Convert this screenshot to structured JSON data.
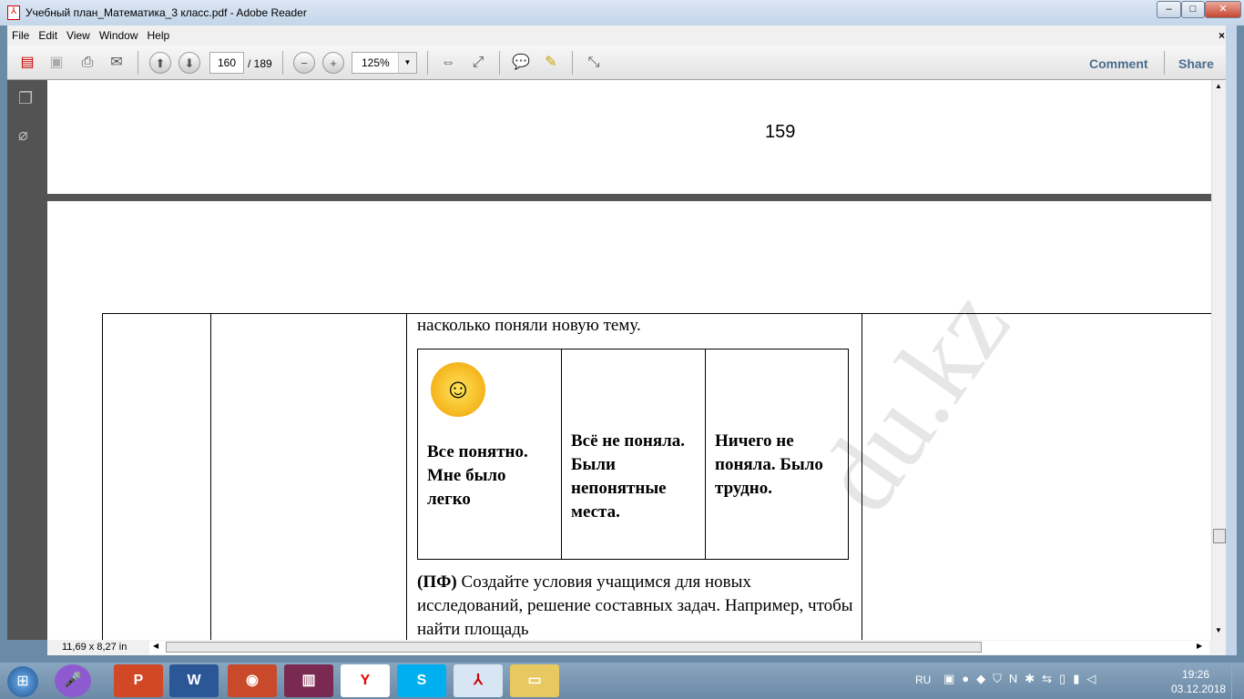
{
  "window": {
    "title": "Учебный план_Математика_3 класс.pdf - Adobe Reader",
    "minimize": "–",
    "maximize": "□",
    "close": "✕"
  },
  "menu": [
    "File",
    "Edit",
    "View",
    "Window",
    "Help"
  ],
  "menu_close": "×",
  "toolbar": {
    "page_current": "160",
    "page_total": "/ 189",
    "zoom": "125%",
    "comment": "Comment",
    "share": "Share"
  },
  "document": {
    "page_number": "159",
    "intro": "насколько поняли новую тему.",
    "options": [
      {
        "text": "Все понятно. Мне было легко"
      },
      {
        "text": "Всё не поняла. Были непонятные места."
      },
      {
        "text": "Ничего не поняла. Было трудно."
      }
    ],
    "pf_label": "(ПФ)",
    "pf_text": " Создайте условия учащимся для новых исследований,  решение составных задач. Например, чтобы найти площадь",
    "watermark": "du.kz"
  },
  "status": {
    "page_size": "11,69 x 8,27 in"
  },
  "taskbar": {
    "lang": "RU",
    "time": "19:26",
    "date": "03.12.2018"
  }
}
